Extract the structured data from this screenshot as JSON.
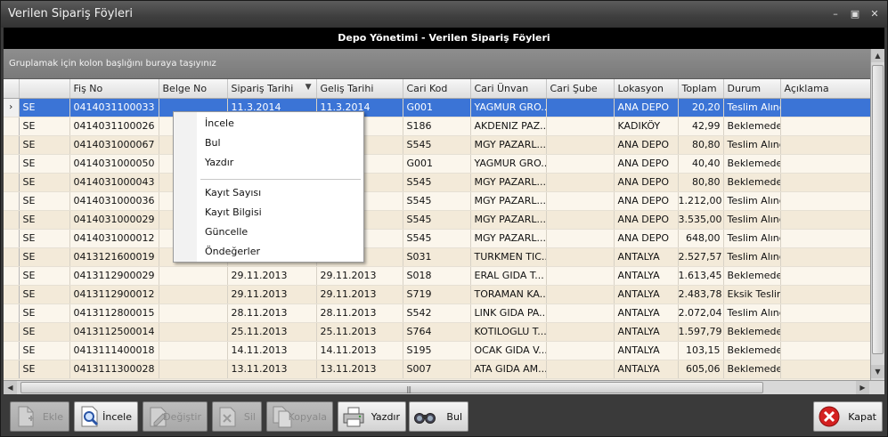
{
  "window": {
    "title": "Verilen Sipariş Föyleri"
  },
  "header": {
    "title": "Depo Yönetimi - Verilen Sipariş Föyleri"
  },
  "group_panel": {
    "hint": "Gruplamak için kolon başlığını buraya taşıyınız"
  },
  "columns": [
    "",
    "Fiş No",
    "Belge No",
    "Sipariş Tarihi",
    "Geliş Tarihi",
    "Cari Kod",
    "Cari Ünvan",
    "Cari Şube",
    "Lokasyon",
    "Toplam",
    "Durum",
    "Açıklama"
  ],
  "rows": [
    {
      "type": "SE",
      "fis": "0414031100033",
      "belge": "",
      "siparis": "11.3.2014",
      "gelis": "11.3.2014",
      "kod": "G001",
      "unvan": "YAGMUR GRO...",
      "sube": "",
      "lokasyon": "ANA DEPO",
      "toplam": "20,20",
      "durum": "Teslim Alındı",
      "aciklama": ""
    },
    {
      "type": "SE",
      "fis": "0414031100026",
      "belge": "",
      "siparis": "",
      "gelis": "",
      "kod": "S186",
      "unvan": "AKDENIZ PAZ...",
      "sube": "",
      "lokasyon": "KADIKÖY",
      "toplam": "42,99",
      "durum": "Beklemede",
      "aciklama": ""
    },
    {
      "type": "SE",
      "fis": "0414031000067",
      "belge": "",
      "siparis": "",
      "gelis": "",
      "kod": "S545",
      "unvan": "MGY PAZARL...",
      "sube": "",
      "lokasyon": "ANA DEPO",
      "toplam": "80,80",
      "durum": "Teslim Alındı",
      "aciklama": ""
    },
    {
      "type": "SE",
      "fis": "0414031000050",
      "belge": "",
      "siparis": "",
      "gelis": "",
      "kod": "G001",
      "unvan": "YAGMUR GRO...",
      "sube": "",
      "lokasyon": "ANA DEPO",
      "toplam": "40,40",
      "durum": "Beklemede",
      "aciklama": ""
    },
    {
      "type": "SE",
      "fis": "0414031000043",
      "belge": "",
      "siparis": "",
      "gelis": "",
      "kod": "S545",
      "unvan": "MGY PAZARL...",
      "sube": "",
      "lokasyon": "ANA DEPO",
      "toplam": "80,80",
      "durum": "Beklemede",
      "aciklama": ""
    },
    {
      "type": "SE",
      "fis": "0414031000036",
      "belge": "",
      "siparis": "",
      "gelis": "",
      "kod": "S545",
      "unvan": "MGY PAZARL...",
      "sube": "",
      "lokasyon": "ANA DEPO",
      "toplam": "1.212,00",
      "durum": "Teslim Alındı",
      "aciklama": ""
    },
    {
      "type": "SE",
      "fis": "0414031000029",
      "belge": "",
      "siparis": "",
      "gelis": "",
      "kod": "S545",
      "unvan": "MGY PAZARL...",
      "sube": "",
      "lokasyon": "ANA DEPO",
      "toplam": "3.535,00",
      "durum": "Teslim Alındı",
      "aciklama": ""
    },
    {
      "type": "SE",
      "fis": "0414031000012",
      "belge": "",
      "siparis": "",
      "gelis": "",
      "kod": "S545",
      "unvan": "MGY PAZARL...",
      "sube": "",
      "lokasyon": "ANA DEPO",
      "toplam": "648,00",
      "durum": "Teslim Alındı",
      "aciklama": ""
    },
    {
      "type": "SE",
      "fis": "0413121600019",
      "belge": "",
      "siparis": "",
      "gelis": "3",
      "kod": "S031",
      "unvan": "TURKMEN TIC...",
      "sube": "",
      "lokasyon": "ANTALYA",
      "toplam": "2.527,57",
      "durum": "Teslim Alındı",
      "aciklama": ""
    },
    {
      "type": "SE",
      "fis": "0413112900029",
      "belge": "",
      "siparis": "29.11.2013",
      "gelis": "29.11.2013",
      "kod": "S018",
      "unvan": "ERAL GIDA T...",
      "sube": "",
      "lokasyon": "ANTALYA",
      "toplam": "1.613,45",
      "durum": "Beklemede",
      "aciklama": ""
    },
    {
      "type": "SE",
      "fis": "0413112900012",
      "belge": "",
      "siparis": "29.11.2013",
      "gelis": "29.11.2013",
      "kod": "S719",
      "unvan": "TORAMAN KA...",
      "sube": "",
      "lokasyon": "ANTALYA",
      "toplam": "2.483,78",
      "durum": "Eksik Teslim",
      "aciklama": ""
    },
    {
      "type": "SE",
      "fis": "0413112800015",
      "belge": "",
      "siparis": "28.11.2013",
      "gelis": "28.11.2013",
      "kod": "S542",
      "unvan": "LINK GIDA PA...",
      "sube": "",
      "lokasyon": "ANTALYA",
      "toplam": "2.072,04",
      "durum": "Teslim Alındı",
      "aciklama": ""
    },
    {
      "type": "SE",
      "fis": "0413112500014",
      "belge": "",
      "siparis": "25.11.2013",
      "gelis": "25.11.2013",
      "kod": "S764",
      "unvan": "KOTILOGLU T...",
      "sube": "",
      "lokasyon": "ANTALYA",
      "toplam": "1.597,79",
      "durum": "Beklemede",
      "aciklama": ""
    },
    {
      "type": "SE",
      "fis": "0413111400018",
      "belge": "",
      "siparis": "14.11.2013",
      "gelis": "14.11.2013",
      "kod": "S195",
      "unvan": "OCAK GIDA V...",
      "sube": "",
      "lokasyon": "ANTALYA",
      "toplam": "103,15",
      "durum": "Beklemede",
      "aciklama": ""
    },
    {
      "type": "SE",
      "fis": "0413111300028",
      "belge": "",
      "siparis": "13.11.2013",
      "gelis": "13.11.2013",
      "kod": "S007",
      "unvan": "ATA GIDA AM...",
      "sube": "",
      "lokasyon": "ANTALYA",
      "toplam": "605,06",
      "durum": "Beklemede",
      "aciklama": ""
    }
  ],
  "context_menu": {
    "items": [
      "İncele",
      "Bul",
      "Yazdır",
      "Kayıt Sayısı",
      "Kayıt Bilgisi",
      "Güncelle",
      "Öndeğerler"
    ]
  },
  "toolbar": {
    "ekle": "Ekle",
    "incele": "İncele",
    "degistir": "Değiştir",
    "sil": "Sil",
    "kopyala": "Kopyala",
    "yazdir": "Yazdır",
    "bul": "Bul",
    "kapat": "Kapat"
  },
  "colors": {
    "selection": "#3b74d6",
    "row_even": "#fbf6ec",
    "row_odd": "#f3ead9",
    "header_strip": "#000000",
    "close_red": "#d42020"
  }
}
